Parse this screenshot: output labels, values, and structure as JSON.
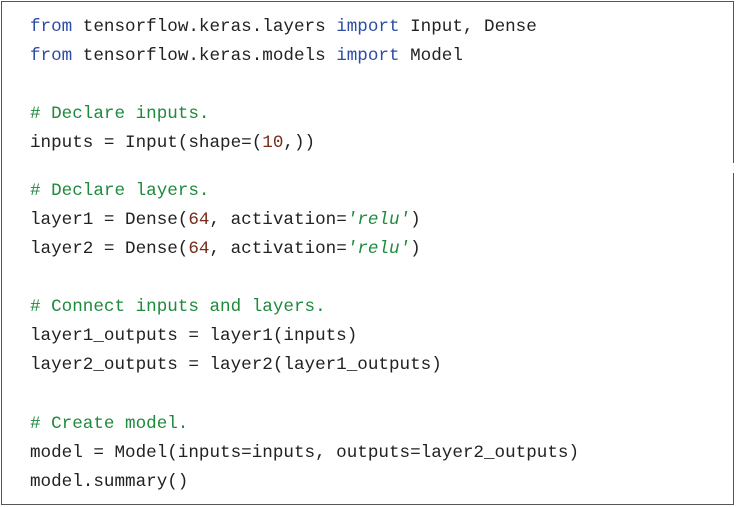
{
  "code_lines": [
    [
      {
        "text": "from",
        "type": "keyword"
      },
      {
        "text": " tensorflow.keras.layers ",
        "type": "plain"
      },
      {
        "text": "import",
        "type": "keyword"
      },
      {
        "text": " Input, Dense",
        "type": "plain"
      }
    ],
    [
      {
        "text": "from",
        "type": "keyword"
      },
      {
        "text": " tensorflow.keras.models ",
        "type": "plain"
      },
      {
        "text": "import",
        "type": "keyword"
      },
      {
        "text": " Model",
        "type": "plain"
      }
    ],
    [],
    [
      {
        "text": "# Declare inputs.",
        "type": "comment"
      }
    ],
    [
      {
        "text": "inputs = Input(shape=(",
        "type": "plain"
      },
      {
        "text": "10",
        "type": "number"
      },
      {
        "text": ",))",
        "type": "plain"
      }
    ],
    [
      {
        "text": "# Declare layers.",
        "type": "comment"
      }
    ],
    [
      {
        "text": "layer1 = Dense(",
        "type": "plain"
      },
      {
        "text": "64",
        "type": "number"
      },
      {
        "text": ", activation=",
        "type": "plain"
      },
      {
        "text": "'relu'",
        "type": "string"
      },
      {
        "text": ")",
        "type": "plain"
      }
    ],
    [
      {
        "text": "layer2 = Dense(",
        "type": "plain"
      },
      {
        "text": "64",
        "type": "number"
      },
      {
        "text": ", activation=",
        "type": "plain"
      },
      {
        "text": "'relu'",
        "type": "string"
      },
      {
        "text": ")",
        "type": "plain"
      }
    ],
    [],
    [
      {
        "text": "# Connect inputs and layers.",
        "type": "comment"
      }
    ],
    [
      {
        "text": "layer1_outputs = layer1(inputs)",
        "type": "plain"
      }
    ],
    [
      {
        "text": "layer2_outputs = layer2(layer1_outputs)",
        "type": "plain"
      }
    ],
    [],
    [
      {
        "text": "# Create model.",
        "type": "comment"
      }
    ],
    [
      {
        "text": "model = Model(inputs=inputs, outputs=layer2_outputs)",
        "type": "plain"
      }
    ],
    [
      {
        "text": "model.summary()",
        "type": "plain"
      }
    ]
  ],
  "colors": {
    "keyword": "#2c4da5",
    "comment": "#1e8a3c",
    "number": "#7a2a18",
    "string": "#1e8a3c",
    "plain": "#222222",
    "border": "#555555"
  }
}
